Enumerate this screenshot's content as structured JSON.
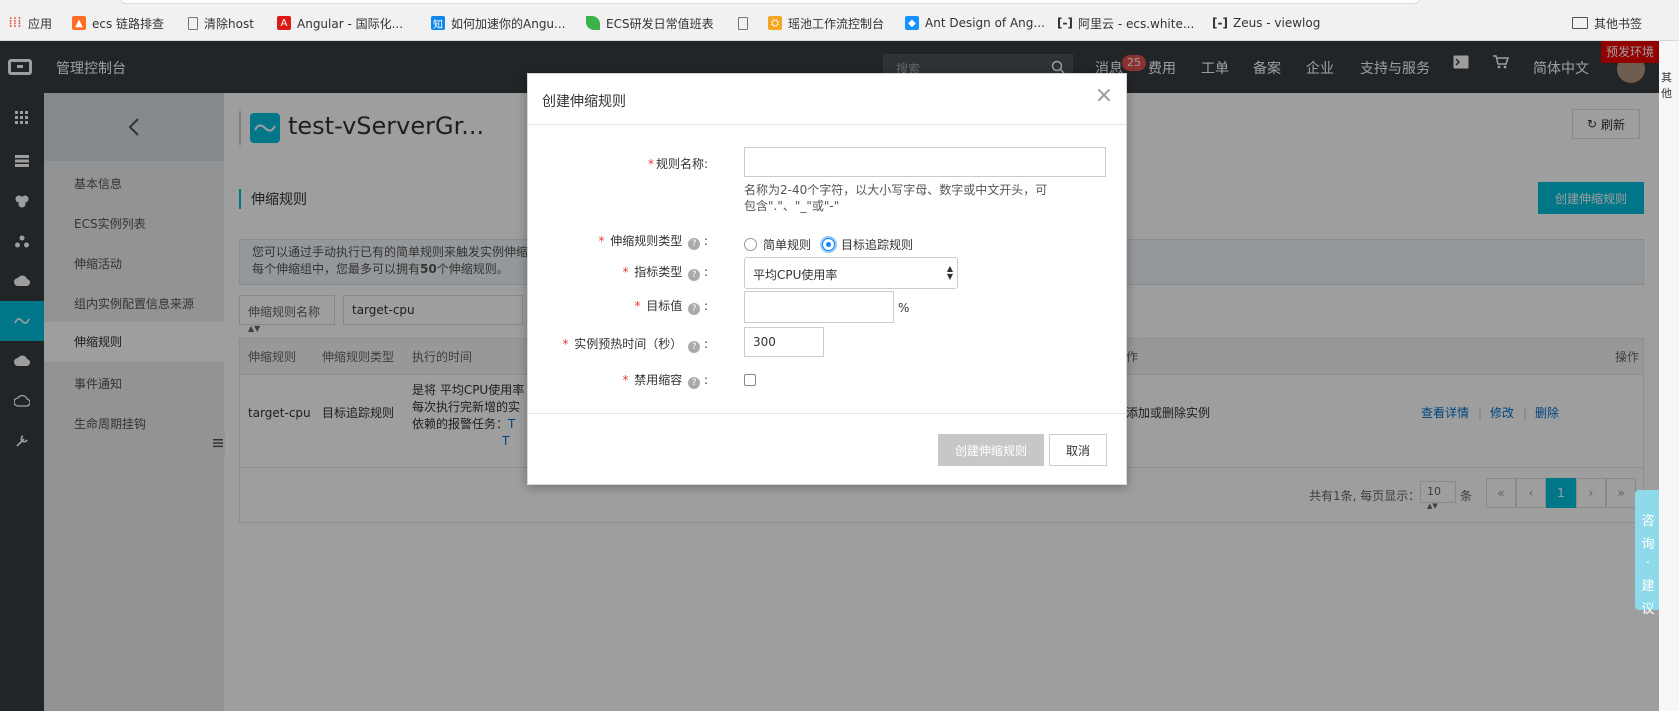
{
  "bookmarks": [
    {
      "label": "应用",
      "icon": "apps-grid-icon",
      "color": "#e9453a"
    },
    {
      "label": "ecs 链路排查",
      "icon": "gitlab-icon",
      "color": "#fc6d26"
    },
    {
      "label": "清除host",
      "icon": "page-icon",
      "color": "#888888"
    },
    {
      "label": "Angular - 国际化...",
      "icon": "angular-icon",
      "color": "#dd1b16"
    },
    {
      "label": "如何加速你的Angu...",
      "icon": "zhihu-icon",
      "color": "#0f88eb"
    },
    {
      "label": "ECS研发日常值班表",
      "icon": "leaf-icon",
      "color": "#3cb34a"
    },
    {
      "label": "",
      "icon": "page-icon",
      "color": "#888888"
    },
    {
      "label": "瑶池工作流控制台",
      "icon": "workflow-icon",
      "color": "#f5a623"
    },
    {
      "label": "Ant Design of Ang...",
      "icon": "ant-design-icon",
      "color": "#1890ff"
    },
    {
      "label": "阿里云 - ecs.white...",
      "icon": "aliyun-icon",
      "color": "#333333"
    },
    {
      "label": "Zeus - viewlog",
      "icon": "aliyun-icon",
      "color": "#333333"
    }
  ],
  "bookmarks_other": "其他书签",
  "topbar": {
    "title": "管理控制台",
    "search_placeholder": "搜索",
    "messages": "消息",
    "messages_badge": "25",
    "nav": [
      "费用",
      "工单",
      "备案",
      "企业",
      "支持与服务"
    ],
    "language": "简体中文",
    "env_badge": "预发环境",
    "right_edge_text": "其他"
  },
  "subnav": {
    "items": [
      "基本信息",
      "ECS实例列表",
      "伸缩活动",
      "组内实例配置信息来源",
      "伸缩规则",
      "事件通知",
      "生命周期挂钩"
    ],
    "active_index": 4
  },
  "page": {
    "title": "test-vServerGr...",
    "refresh": "刷新",
    "section": "伸缩规则",
    "create_button": "创建伸缩规则",
    "tip_line1": "您可以通过手动执行已有的简单规则来触发实例伸缩",
    "tip_line2_pre": "每个伸缩组中，您最多可以拥有",
    "tip_count": "50",
    "tip_line2_post": "个伸缩规则。",
    "filter_select": "伸缩规则名称",
    "filter_value": "target-cpu"
  },
  "table": {
    "headers": [
      "伸缩规则",
      "伸缩规则类型",
      "执行的时间",
      "执行的操作",
      "操作"
    ],
    "row": {
      "name": "target-cpu",
      "type": "目标追踪规则",
      "desc1": "是将 平均CPU使用率",
      "desc2": "每次执行完新增的实",
      "desc3": "依赖的报警任务：",
      "link1": "T",
      "link2": "T",
      "action": "根据需要添加或删除实例",
      "ops": [
        "查看详情",
        "修改",
        "删除"
      ]
    }
  },
  "pager": {
    "info": "共有1条, 每页显示：",
    "size": "10",
    "unit": "条",
    "current": "1"
  },
  "feedback": [
    "咨",
    "询",
    "·",
    "建",
    "议"
  ],
  "modal": {
    "title": "创建伸缩规则",
    "name_label": "规则名称:",
    "name_value": "",
    "name_hint": "名称为2-40个字符，以大小写字母、数字或中文开头，可包含\".\"、\"_\"或\"-\"",
    "type_label": "伸缩规则类型",
    "type_options": [
      "简单规则",
      "目标追踪规则"
    ],
    "type_selected": "目标追踪规则",
    "metric_label": "指标类型",
    "metric_value": "平均CPU使用率",
    "target_label": "目标值",
    "target_value": "",
    "target_unit": "%",
    "warmup_label": "实例预热时间（秒）",
    "warmup_value": "300",
    "disable_label": "禁用缩容",
    "colon": ":",
    "submit": "创建伸缩规则",
    "cancel": "取消"
  },
  "colors": {
    "accent": "#00c1de",
    "topbar": "#373d41",
    "danger": "#e4393c"
  }
}
